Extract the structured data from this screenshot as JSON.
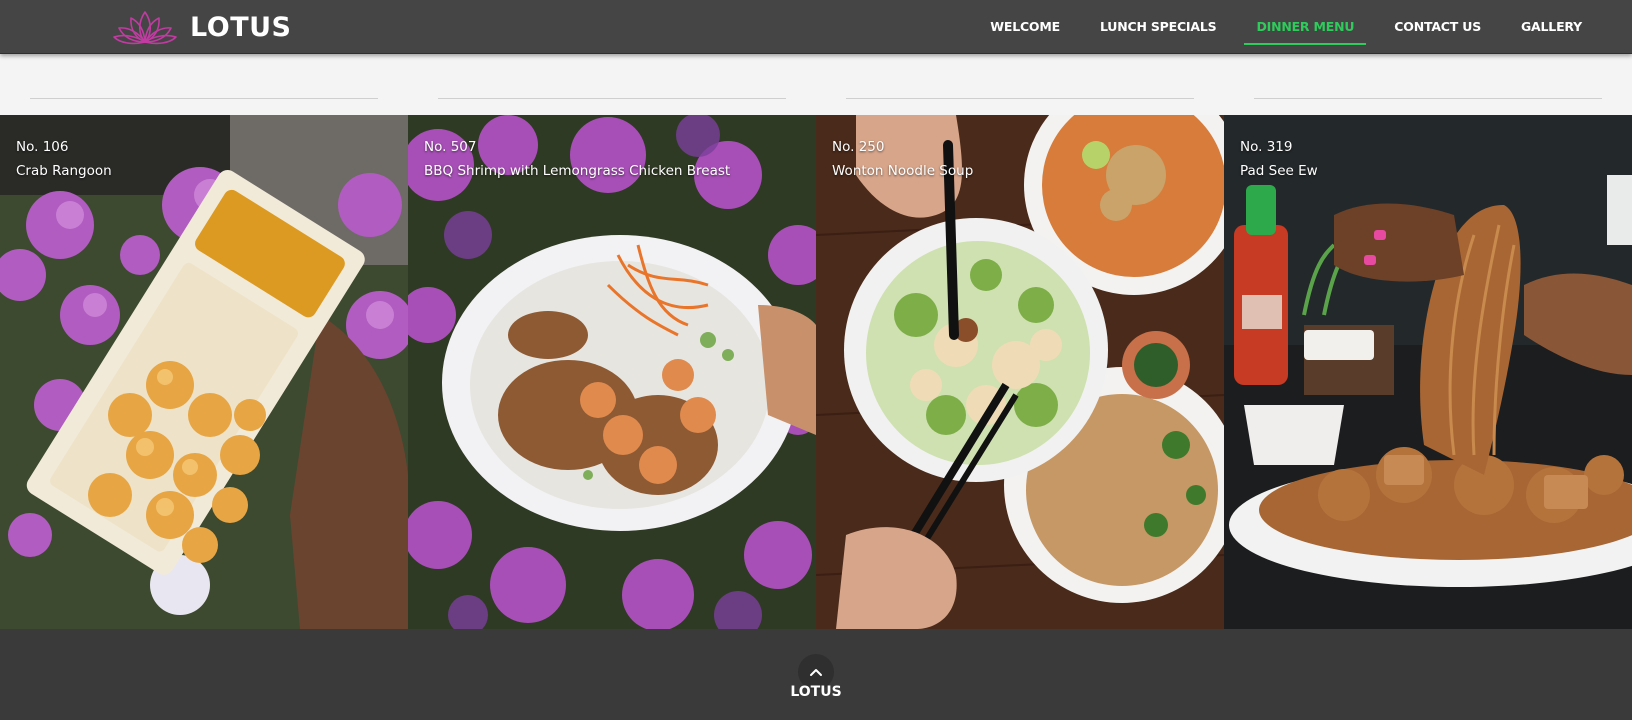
{
  "brand": {
    "name": "LOTUS",
    "logo": "lotus-logo",
    "logo_color": "#c13ba2"
  },
  "nav": {
    "items": [
      {
        "label": "WELCOME",
        "active": false
      },
      {
        "label": "LUNCH SPECIALS",
        "active": false
      },
      {
        "label": "DINNER MENU",
        "active": true
      },
      {
        "label": "CONTACT US",
        "active": false
      },
      {
        "label": "GALLERY",
        "active": false
      }
    ],
    "active_color": "#2ecc5b"
  },
  "gallery": {
    "items": [
      {
        "number": "No. 106",
        "name": "Crab Rangoon"
      },
      {
        "number": "No. 507",
        "name": "BBQ Shrimp with Lemongrass Chicken Breast"
      },
      {
        "number": "No. 250",
        "name": "Wonton Noodle Soup"
      },
      {
        "number": "No. 319",
        "name": "Pad See Ew"
      }
    ]
  },
  "footer": {
    "back_to_top_icon": "chevron-up-icon",
    "brand": "LOTUS"
  }
}
